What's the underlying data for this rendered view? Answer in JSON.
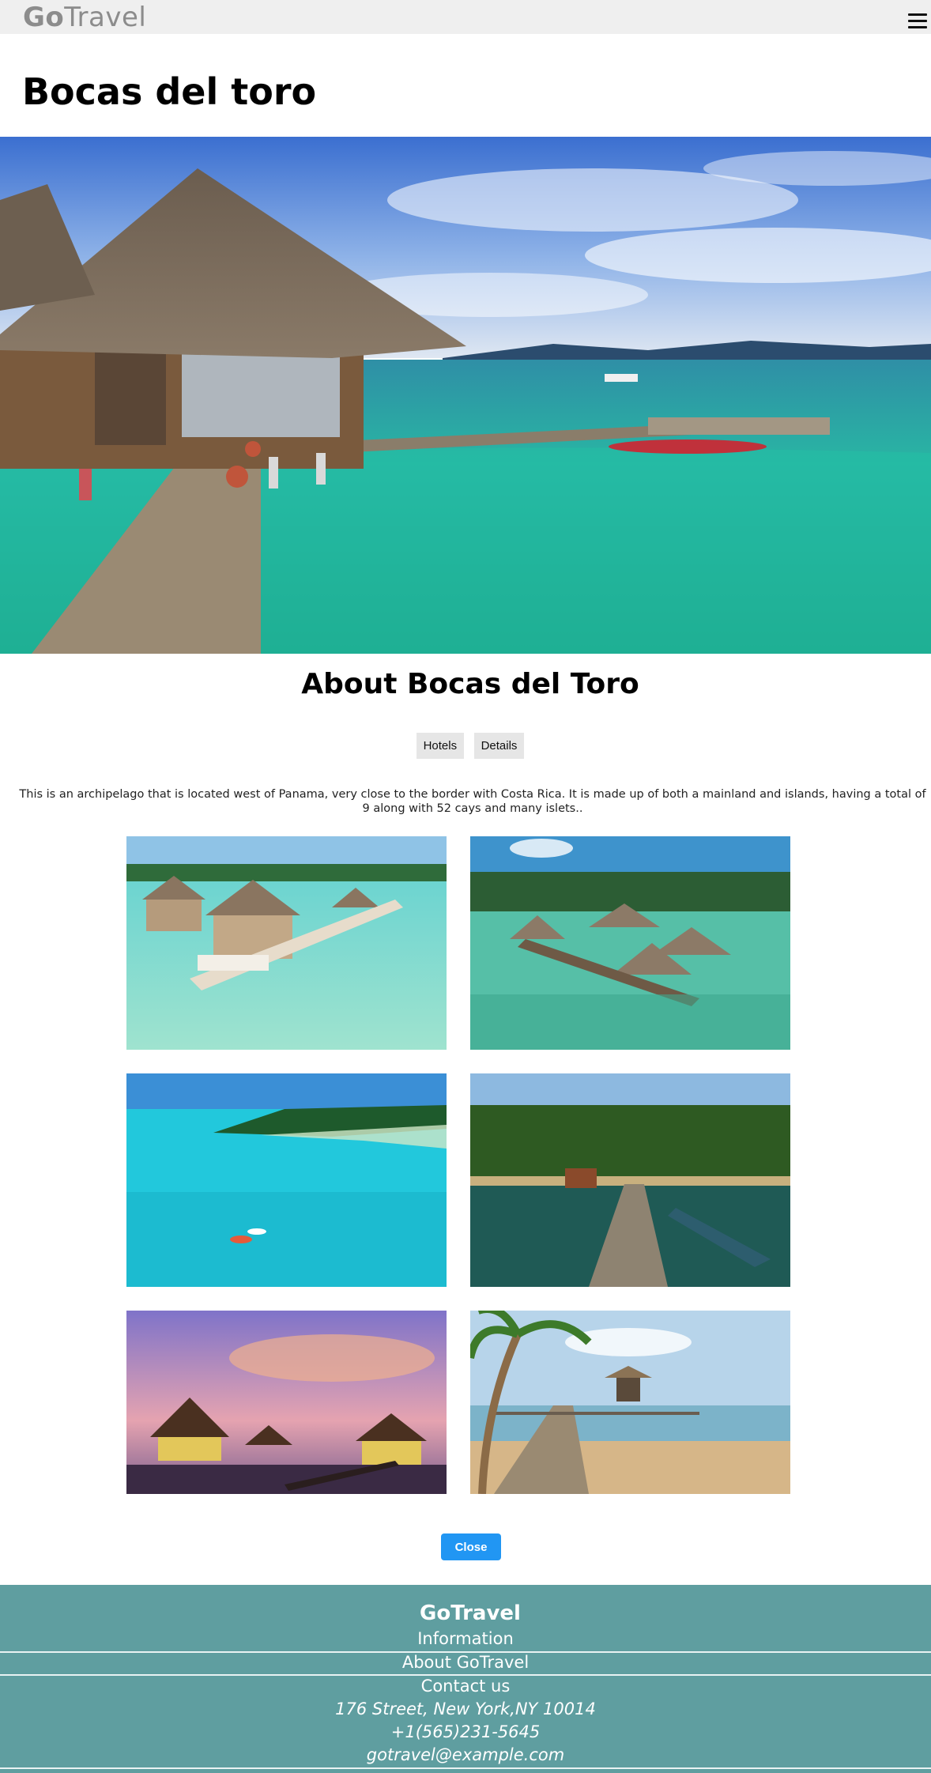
{
  "header": {
    "logo_bold": "Go",
    "logo_rest": "Travel",
    "menu_icon": "hamburger-menu-icon"
  },
  "page": {
    "title": "Bocas del toro"
  },
  "about": {
    "title": "About Bocas del Toro",
    "tabs": [
      {
        "label": "Hotels"
      },
      {
        "label": "Details"
      }
    ],
    "description": "This is an archipelago that is located west of Panama, very close to the border with Costa Rica. It is made up of both a mainland and islands, having a total of 9 along with 52 cays and many islets.."
  },
  "actions": {
    "close_label": "Close"
  },
  "footer": {
    "brand": "GoTravel",
    "links": [
      {
        "label": "Information"
      },
      {
        "label": "About GoTravel"
      },
      {
        "label": "Contact us"
      }
    ],
    "address": "176 Street, New York,NY 10014",
    "phone": "+1(565)231-5645",
    "email": "gotravel@example.com"
  },
  "colors": {
    "navbar_bg": "#efefef",
    "logo": "#8c8c8c",
    "tab_bg": "#e6e6e6",
    "close_button": "#2196f3",
    "footer_bg": "#5f9ea0",
    "footer_rule": "#e9f3f3"
  }
}
